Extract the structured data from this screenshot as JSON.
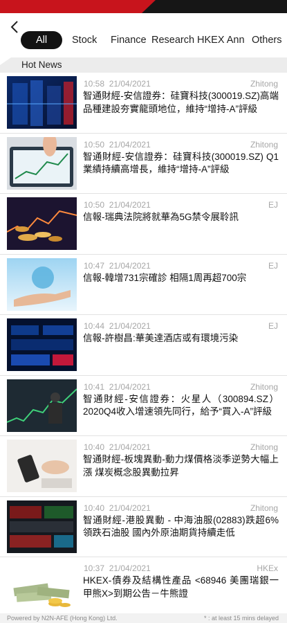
{
  "tabs": [
    {
      "label": "All",
      "active": true
    },
    {
      "label": "Stock",
      "active": false
    },
    {
      "label": "Finance",
      "active": false
    },
    {
      "label": "Research",
      "active": false
    },
    {
      "label": "HKEX Ann",
      "active": false
    },
    {
      "label": "Others",
      "active": false
    }
  ],
  "section": {
    "title": "Hot News"
  },
  "news": [
    {
      "time": "10:58",
      "date": "21/04/2021",
      "source": "Zhitong",
      "title": "智通財經-安信證券：硅寶科技(300019.SZ)高端品種建設夯實龍頭地位，維持“增持-A”評級",
      "thumb": "tech-server-image"
    },
    {
      "time": "10:50",
      "date": "21/04/2021",
      "source": "Zhitong",
      "title": "智通財經-安信證券：硅寶科技(300019.SZ) Q1業績持續高增長，維持“增持-A”評級",
      "thumb": "tablet-chart-image"
    },
    {
      "time": "10:50",
      "date": "21/04/2021",
      "source": "EJ",
      "title": "信報-瑞典法院將就華為5G禁令展聆訊",
      "thumb": "coins-chart-image"
    },
    {
      "time": "10:47",
      "date": "21/04/2021",
      "source": "EJ",
      "title": "信報-韓增731宗確診 相隔1周再超700宗",
      "thumb": "globe-hand-image"
    },
    {
      "time": "10:44",
      "date": "21/04/2021",
      "source": "EJ",
      "title": "信報-許樹昌:華美達酒店或有環境污染",
      "thumb": "stock-board-image"
    },
    {
      "time": "10:41",
      "date": "21/04/2021",
      "source": "Zhitong",
      "title": "智通財經-安信證券：火星人（300894.SZ）2020Q4收入增速領先同行，給予“買入-A”評級",
      "thumb": "businessman-chart-image"
    },
    {
      "time": "10:40",
      "date": "21/04/2021",
      "source": "Zhitong",
      "title": "智通財經-板塊異動-動力煤價格淡季逆勢大幅上漲 煤炭概念股異動拉昇",
      "thumb": "desk-phone-image"
    },
    {
      "time": "10:40",
      "date": "21/04/2021",
      "source": "Zhitong",
      "title": "智通財經-港股異動 - 中海油服(02883)跌超6%領跌石油股 國內外原油期貨持續走低",
      "thumb": "ticker-screen-image"
    },
    {
      "time": "10:37",
      "date": "21/04/2021",
      "source": "HKEx",
      "title": "HKEX-債券及結構性產品 <68946 美團瑞銀一甲熊X>到期公告－牛熊證",
      "thumb": "money-stack-image"
    }
  ],
  "footer": {
    "left": "Powered by N2N-AFE (Hong Kong) Ltd.",
    "right": "* : at least 15 mins delayed"
  },
  "colors": {
    "accent": "#c8141c",
    "active_tab": "#121212",
    "meta_text": "#a6a6a6"
  },
  "icons": {
    "back": "chevron-left-icon"
  }
}
